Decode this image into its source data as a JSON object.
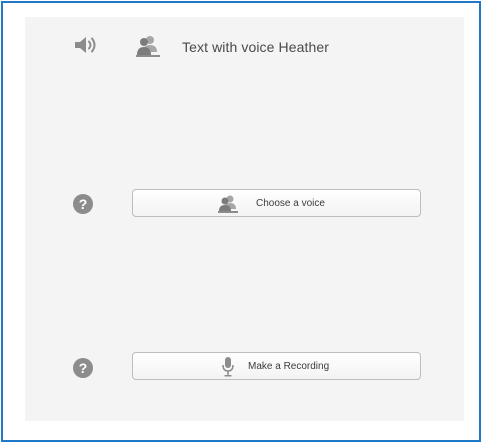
{
  "voice": {
    "title": "Text with voice Heather"
  },
  "buttons": {
    "choose_voice": "Choose a voice",
    "make_recording": "Make a Recording"
  },
  "help": {
    "glyph": "?"
  },
  "icons": {
    "speaker": "speaker-icon",
    "people": "people-icon",
    "microphone": "microphone-icon",
    "help": "help-icon"
  },
  "colors": {
    "frame_border": "#1f78c8",
    "panel_bg": "#f4f4f4",
    "icon_gray": "#8c8c8c",
    "text": "#4a4a4a"
  }
}
